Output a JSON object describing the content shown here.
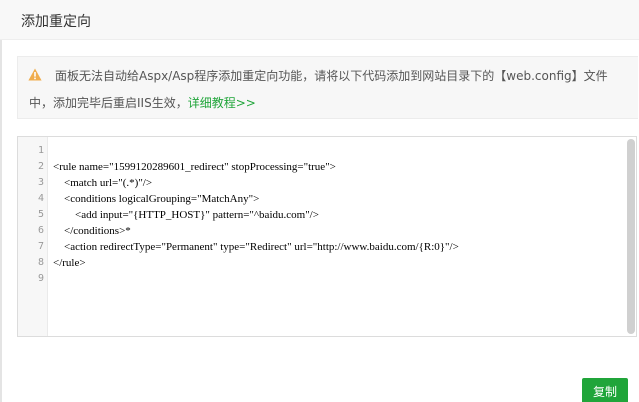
{
  "dialog": {
    "title": "添加重定向"
  },
  "notice": {
    "icon": "warning-icon",
    "line1": "面板无法自动给Aspx/Asp程序添加重定向功能，请将以下代码添加到网站目录下的【web.config】文件",
    "line2_prefix": "中，添加完毕后重启IIS生效，",
    "link_label": "详细教程>>",
    "link_color": "#20a53a"
  },
  "code_editor": {
    "lines": [
      {
        "num": "1",
        "text": ""
      },
      {
        "num": "2",
        "text": "<rule name=\"1599120289601_redirect\" stopProcessing=\"true\">"
      },
      {
        "num": "3",
        "text": "    <match url=\"(.*)\"/>"
      },
      {
        "num": "4",
        "text": "    <conditions logicalGrouping=\"MatchAny\">"
      },
      {
        "num": "5",
        "text": "        <add input=\"{HTTP_HOST}\" pattern=\"^baidu.com\"/>"
      },
      {
        "num": "6",
        "text": "    </conditions>*"
      },
      {
        "num": "7",
        "text": "    <action redirectType=\"Permanent\" type=\"Redirect\" url=\"http://www.baidu.com/{R:0}\"/>"
      },
      {
        "num": "8",
        "text": "</rule>"
      },
      {
        "num": "9",
        "text": ""
      }
    ]
  },
  "footer": {
    "copy_label": "复制",
    "accent_color": "#20a53a"
  }
}
